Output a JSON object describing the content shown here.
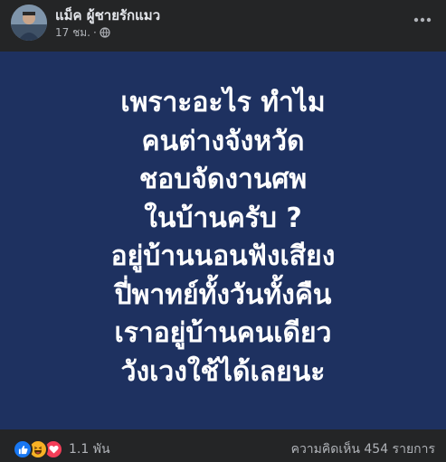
{
  "post": {
    "author": "แม็ค ผู้ชายรักแมว",
    "time": "17 ชม.",
    "separator": "·",
    "privacy_icon": "globe-icon",
    "more_icon": "more-horizontal-icon"
  },
  "content": {
    "background": "#1e3160",
    "text_color": "#ffffff",
    "lines": [
      "เพราะอะไร ทำไม",
      "คนต่างจังหวัด",
      "ชอบจัดงานศพ",
      "ในบ้านครับ ?",
      "อยู่บ้านนอนฟังเสียง",
      "ปี่พาทย์ทั้งวันทั้งคืน",
      "เราอยู่บ้านคนเดียว",
      "วังเวงใช้ได้เลยนะ"
    ]
  },
  "footer": {
    "reaction_icons": [
      "like-icon",
      "haha-icon",
      "love-icon"
    ],
    "reaction_count": "1.1 พัน",
    "comment_count": "ความคิดเห็น 454 รายการ"
  },
  "colors": {
    "page_bg": "#242526",
    "primary_text": "#e4e6eb",
    "secondary_text": "#b0b3b8",
    "like": "#1877f2",
    "haha": "#f7b125",
    "love": "#f33e58"
  }
}
